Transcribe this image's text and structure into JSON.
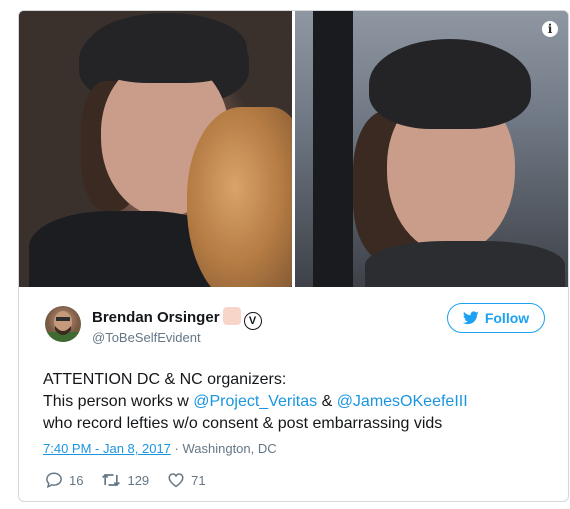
{
  "tweet": {
    "user": {
      "name": "Brendan Orsinger",
      "handle": "@ToBeSelfEvident",
      "verified_mark": "V"
    },
    "follow_label": "Follow",
    "info_icon_label": "i",
    "text": {
      "line1": "ATTENTION DC & NC organizers:",
      "line2_prefix": "This person works w ",
      "mention1": "@Project_Veritas",
      "line2_mid": " & ",
      "mention2": "@JamesOKeefeIII",
      "line3": "who record lefties w/o consent & post embarrassing vids"
    },
    "timestamp": "7:40 PM - Jan 8, 2017",
    "location": " · Washington, DC",
    "stats": {
      "replies": "16",
      "retweets": "129",
      "likes": "71"
    },
    "icons": [
      "info-icon",
      "twitter-bird-icon",
      "reply-icon",
      "retweet-icon",
      "like-icon"
    ],
    "colors": {
      "accent": "#1da1f2",
      "link": "#1b95e0",
      "muted": "#657786"
    }
  }
}
